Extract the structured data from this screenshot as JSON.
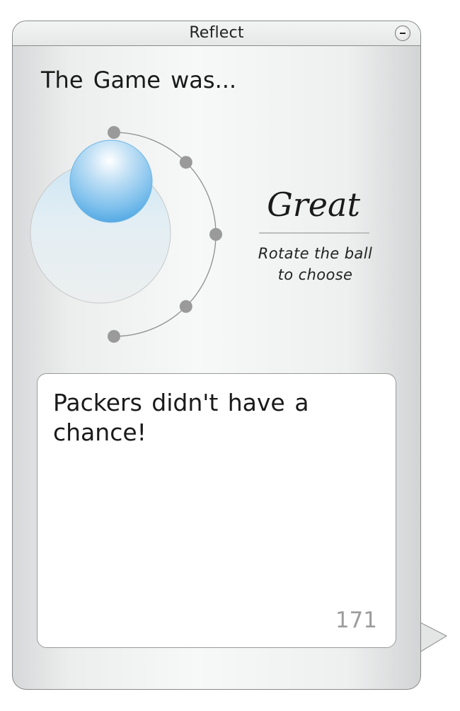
{
  "window": {
    "title": "Reflect",
    "minimize_icon": "minus-icon"
  },
  "prompt": "The Game was...",
  "rating": {
    "selected_label": "Great",
    "hint": "Rotate the ball\nto choose",
    "option_count": 5,
    "selected_index": 0,
    "ball_icon": "selector-ball",
    "track_color": "#8e8e8e",
    "dot_color": "#9a9a9a",
    "ball_color": "#5aaee6"
  },
  "comment": {
    "text": "Packers didn't have a chance!",
    "remaining_characters": "171"
  }
}
